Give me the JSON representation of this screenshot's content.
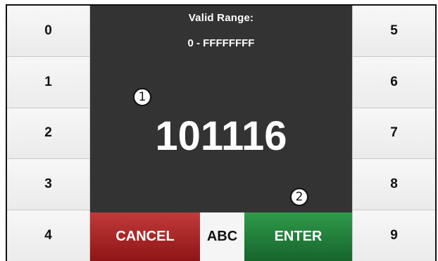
{
  "display": {
    "range_label": "Valid Range:",
    "range_value": "0 - FFFFFFFF",
    "value": "101116"
  },
  "callouts": [
    "1",
    "2"
  ],
  "keypad": {
    "left": [
      "0",
      "1",
      "2",
      "3",
      "4"
    ],
    "right": [
      "5",
      "6",
      "7",
      "8",
      "9"
    ]
  },
  "actions": {
    "cancel": "CANCEL",
    "abc": "ABC",
    "enter": "ENTER"
  },
  "colors": {
    "display_bg": "#333333",
    "cancel": "#a82020",
    "enter": "#1f7f38",
    "key_bg": "#f2f2f2"
  }
}
